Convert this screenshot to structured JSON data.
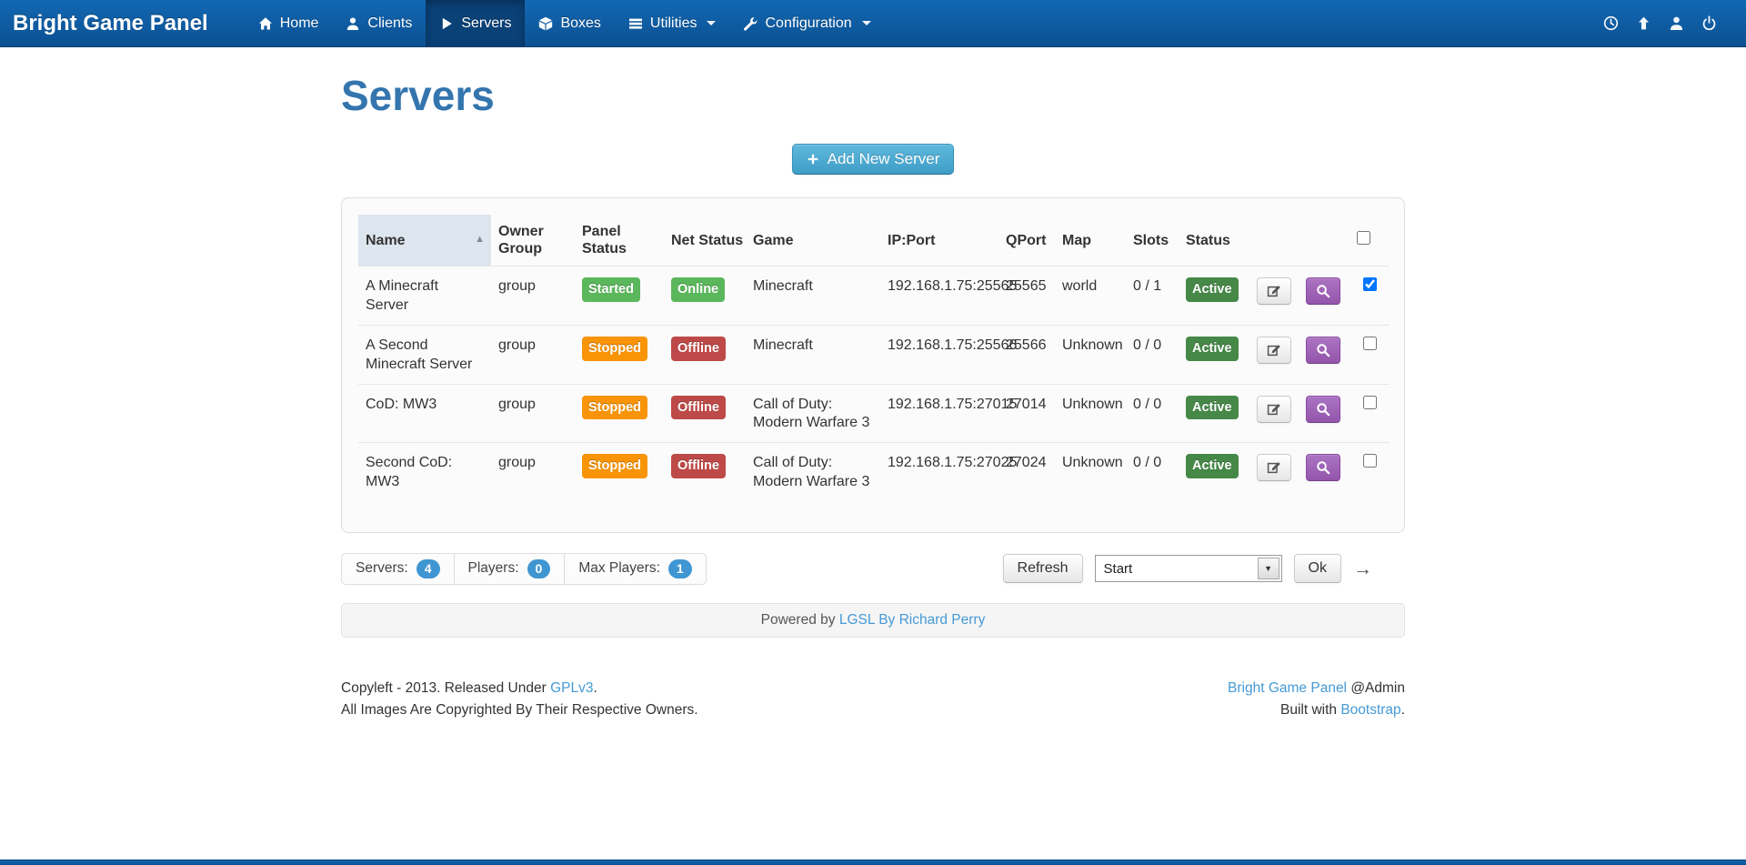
{
  "navbar": {
    "brand": "Bright Game Panel",
    "items": [
      {
        "label": "Home",
        "icon": "home-icon",
        "active": false
      },
      {
        "label": "Clients",
        "icon": "user-icon",
        "active": false
      },
      {
        "label": "Servers",
        "icon": "play-icon",
        "active": true
      },
      {
        "label": "Boxes",
        "icon": "box-icon",
        "active": false
      },
      {
        "label": "Utilities",
        "icon": "list-icon",
        "active": false,
        "dropdown": true
      },
      {
        "label": "Configuration",
        "icon": "wrench-icon",
        "active": false,
        "dropdown": true
      }
    ],
    "right_icons": [
      "clock-icon",
      "arrow-up-icon",
      "user-icon",
      "power-icon"
    ]
  },
  "page": {
    "title": "Servers"
  },
  "toolbar": {
    "add_server_label": "Add New Server",
    "add_server_icon": "plus-icon"
  },
  "table": {
    "headers": {
      "name": "Name",
      "owner_group": "Owner Group",
      "panel_status": "Panel Status",
      "net_status": "Net Status",
      "game": "Game",
      "ip_port": "IP:Port",
      "qport": "QPort",
      "map": "Map",
      "slots": "Slots",
      "status": "Status"
    },
    "sorted_column": "Name",
    "sort_direction": "asc",
    "rows": [
      {
        "name": "A Minecraft Server",
        "owner_group": "group",
        "panel_status": "Started",
        "panel_status_color": "#5bb75b",
        "net_status": "Online",
        "net_status_color": "#5bb75b",
        "game": "Minecraft",
        "ip_port": "192.168.1.75:25565",
        "qport": "25565",
        "map": "world",
        "slots": "0 / 1",
        "status": "Active",
        "status_color": "#468847",
        "checked": true
      },
      {
        "name": "A Second Minecraft Server",
        "owner_group": "group",
        "panel_status": "Stopped",
        "panel_status_color": "#f89406",
        "net_status": "Offline",
        "net_status_color": "#bd4a48",
        "game": "Minecraft",
        "ip_port": "192.168.1.75:25566",
        "qport": "25566",
        "map": "Unknown",
        "slots": "0 / 0",
        "status": "Active",
        "status_color": "#468847",
        "checked": false
      },
      {
        "name": "CoD: MW3",
        "owner_group": "group",
        "panel_status": "Stopped",
        "panel_status_color": "#f89406",
        "net_status": "Offline",
        "net_status_color": "#bd4a48",
        "game": "Call of Duty: Modern Warfare 3",
        "ip_port": "192.168.1.75:27015",
        "qport": "27014",
        "map": "Unknown",
        "slots": "0 / 0",
        "status": "Active",
        "status_color": "#468847",
        "checked": false
      },
      {
        "name": "Second CoD: MW3",
        "owner_group": "group",
        "panel_status": "Stopped",
        "panel_status_color": "#f89406",
        "net_status": "Offline",
        "net_status_color": "#bd4a48",
        "game": "Call of Duty: Modern Warfare 3",
        "ip_port": "192.168.1.75:27025",
        "qport": "27024",
        "map": "Unknown",
        "slots": "0 / 0",
        "status": "Active",
        "status_color": "#468847",
        "checked": false
      }
    ]
  },
  "summary": {
    "servers_label": "Servers:",
    "servers_count": "4",
    "players_label": "Players:",
    "players_count": "0",
    "max_players_label": "Max Players:",
    "max_players_count": "1",
    "badge_color": "#3f96d2"
  },
  "controls": {
    "refresh_label": "Refresh",
    "action_selected": "Start",
    "ok_label": "Ok"
  },
  "powered_by": {
    "prefix": "Powered by ",
    "link": "LGSL By Richard Perry"
  },
  "footer": {
    "copyleft_prefix": "Copyleft - 2013. Released Under ",
    "copyleft_link": "GPLv3",
    "copyleft_suffix": ".",
    "images_line": "All Images Are Copyrighted By Their Respective Owners.",
    "panel_link": "Bright Game Panel",
    "admin_suffix": " @Admin",
    "built_prefix": "Built with ",
    "built_link": "Bootstrap",
    "built_suffix": "."
  },
  "colors": {
    "navbar_blue": "#0c5092",
    "title_blue": "#3475ae",
    "link_blue": "#459ad6",
    "success_green": "#5bb75b",
    "active_green": "#468847",
    "warning_orange": "#f89406",
    "danger_red": "#bd4a48",
    "view_purple": "#9355ab"
  }
}
